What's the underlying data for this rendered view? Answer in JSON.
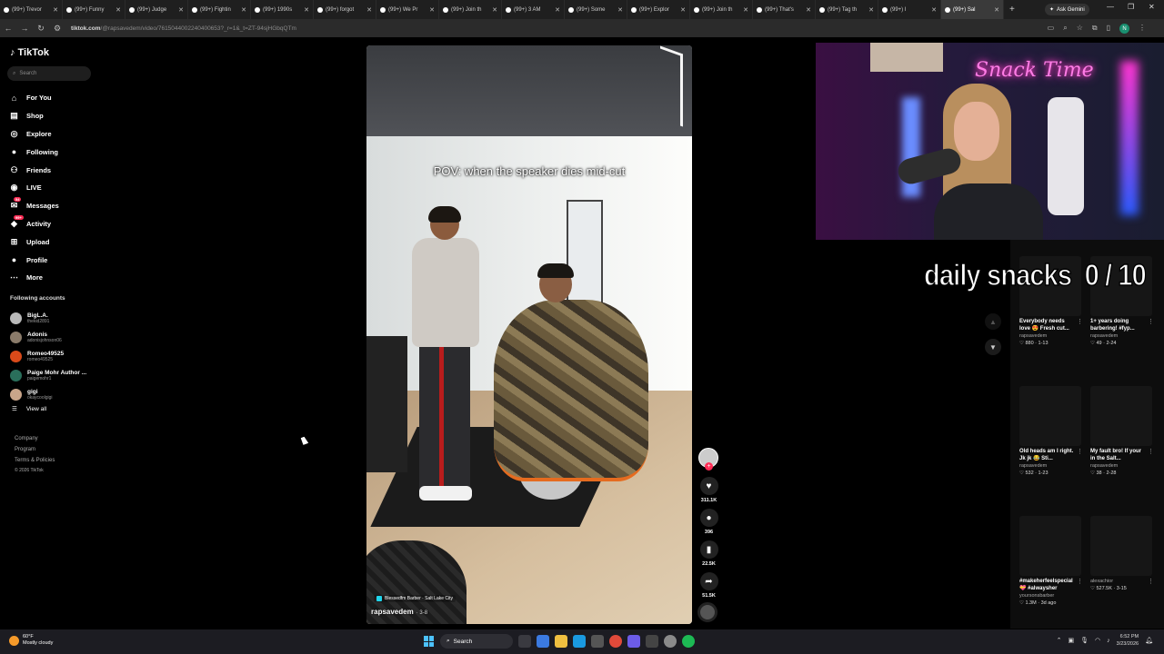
{
  "browser": {
    "tabs": [
      {
        "label": "(99+) Trevor"
      },
      {
        "label": "(99+) Funny"
      },
      {
        "label": "(99+) Judge"
      },
      {
        "label": "(99+) Fightin"
      },
      {
        "label": "(99+) 1990s"
      },
      {
        "label": "(99+) forgot"
      },
      {
        "label": "(99+) We Pr"
      },
      {
        "label": "(99+) Join th"
      },
      {
        "label": "(99+) 3 AM"
      },
      {
        "label": "(99+) Some"
      },
      {
        "label": "(99+) Explor"
      },
      {
        "label": "(99+) Join th"
      },
      {
        "label": "(99+) That's"
      },
      {
        "label": "(99+) Tag th"
      },
      {
        "label": "(99+) I"
      },
      {
        "label": "(99+) Sal"
      }
    ],
    "ask_gemini": "Ask Gemini",
    "url_main": "tiktok.com",
    "url_rest": "/@rapsavedem/video/7615044002240400653?_r=1&_t=ZT-94sjHGbqQTm",
    "profile_letter": "N"
  },
  "sidebar": {
    "logo": "TikTok",
    "search_placeholder": "Search",
    "nav": [
      {
        "label": "For You",
        "icon": "home-icon"
      },
      {
        "label": "Shop",
        "icon": "shop-icon"
      },
      {
        "label": "Explore",
        "icon": "compass-icon"
      },
      {
        "label": "Following",
        "icon": "following-icon"
      },
      {
        "label": "Friends",
        "icon": "friends-icon"
      },
      {
        "label": "LIVE",
        "icon": "live-icon"
      },
      {
        "label": "Messages",
        "icon": "messages-icon",
        "badge": "54"
      },
      {
        "label": "Activity",
        "icon": "activity-icon",
        "badge": "99+"
      },
      {
        "label": "Upload",
        "icon": "upload-icon"
      },
      {
        "label": "Profile",
        "icon": "profile-icon"
      },
      {
        "label": "More",
        "icon": "more-icon"
      }
    ],
    "following_title": "Following accounts",
    "following": [
      {
        "name": "BigL.A.",
        "handle": "thekid2891",
        "color": "#b9b9b9"
      },
      {
        "name": "Adonis",
        "handle": "adonisjohnson06",
        "color": "#8a7b6a"
      },
      {
        "name": "Romeo49525",
        "handle": "romeo49525",
        "color": "#d94a1a"
      },
      {
        "name": "Paige Mohr Author ...",
        "handle": "paigemohr1",
        "color": "#2a6f5b"
      },
      {
        "name": "gigi",
        "handle": "okaycoolgigi",
        "color": "#c9a58a"
      }
    ],
    "view_all": "View all",
    "footer": [
      "Company",
      "Program",
      "Terms & Policies"
    ],
    "copyright": "© 2026 TikTok"
  },
  "video": {
    "caption": "POV: when the speaker dies mid-cut",
    "location": "Blessedfm Barber · Salt Lake City",
    "author": "rapsavedem",
    "date": "3-8"
  },
  "actions": {
    "likes": "311.1K",
    "comments": "396",
    "saves": "22.5K",
    "shares": "51.5K"
  },
  "overlay": {
    "neon_sign": "Snack Time",
    "counter_label": "daily snacks",
    "counter_value": "0 / 10"
  },
  "related": [
    {
      "title": "Everybody needs love 😍 Fresh cut...",
      "user": "rapsavedem",
      "meta": "♡ 880 · 1-13"
    },
    {
      "title": "1+ years doing barbering! #fyp...",
      "user": "rapsavedem",
      "meta": "♡ 49 · 2-24"
    },
    {
      "title": "Old heads am I right. Jk jk 😂 Sti...",
      "user": "rapsavedem",
      "meta": "♡ 532 · 1-23"
    },
    {
      "title": "My fault bro! If your in the Salt...",
      "user": "rapsavedem",
      "meta": "♡ 38 · 2-28"
    },
    {
      "title": "#makeherfeelspecial💝 #alwaysher",
      "user": "yoursonsbarber",
      "meta": "♡ 1.3M · 3d ago"
    },
    {
      "title": "",
      "user": "alexachior",
      "meta": "♡ 527.5K · 3-15"
    }
  ],
  "taskbar": {
    "temp": "60°F",
    "weather": "Mostly cloudy",
    "search": "Search",
    "time": "6:52 PM",
    "date": "3/23/2026"
  }
}
